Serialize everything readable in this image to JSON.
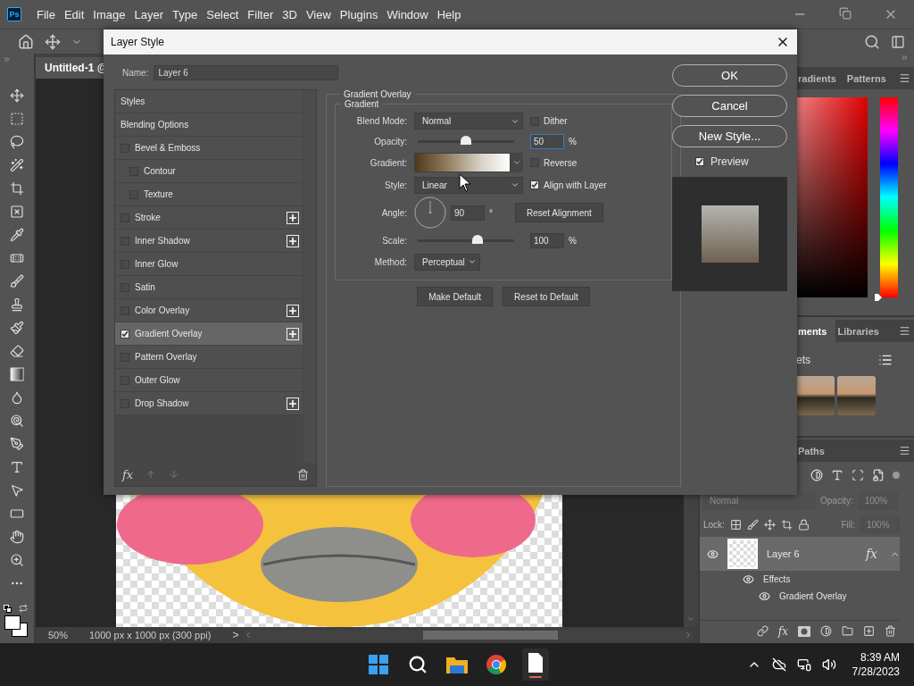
{
  "app": {
    "logo": "Ps",
    "menu": [
      "File",
      "Edit",
      "Image",
      "Layer",
      "Type",
      "Select",
      "Filter",
      "3D",
      "View",
      "Plugins",
      "Window",
      "Help"
    ],
    "doc_tab": "Untitled-1 @",
    "status": {
      "zoom": "50%",
      "info": "1000 px x 1000 px (300 ppi)",
      "arrow": ">"
    }
  },
  "panels": {
    "color_tabs": [
      {
        "label": "radients",
        "selected": false
      },
      {
        "label": "Patterns",
        "selected": false
      }
    ],
    "library_tabs": [
      {
        "label": "ments",
        "selected": true
      },
      {
        "label": "Libraries",
        "selected": false
      }
    ],
    "library_heading": "ets",
    "layers_tabs": [
      {
        "label": "Paths",
        "selected": false
      }
    ],
    "layers": {
      "blend": "Normal",
      "opacity_label": "Opacity:",
      "opacity": "100%",
      "lock_label": "Lock:",
      "fill_label": "Fill:",
      "fill": "100%",
      "disabled": true,
      "fx_button": "fx",
      "rows": [
        {
          "kind": "layer",
          "name": "Layer 6",
          "fx": "fx",
          "selected": true
        },
        {
          "kind": "effects",
          "name": "Effects",
          "selected": false
        },
        {
          "kind": "effect",
          "name": "Gradient Overlay",
          "selected": false
        }
      ]
    }
  },
  "dialog": {
    "title": "Layer Style",
    "name_label": "Name:",
    "name_value": "Layer 6",
    "styles": [
      {
        "label": "Styles",
        "kind": "header",
        "selected": false
      },
      {
        "label": "Blending Options",
        "kind": "header",
        "selected": false
      },
      {
        "label": "Bevel & Emboss",
        "kind": "check",
        "checked": false,
        "add": false,
        "selected": false,
        "children": [
          {
            "label": "Contour",
            "kind": "check",
            "checked": false,
            "add": false,
            "selected": false
          },
          {
            "label": "Texture",
            "kind": "check",
            "checked": false,
            "add": false,
            "selected": false
          }
        ]
      },
      {
        "label": "Stroke",
        "kind": "check",
        "checked": false,
        "add": true,
        "selected": false
      },
      {
        "label": "Inner Shadow",
        "kind": "check",
        "checked": false,
        "add": true,
        "selected": false
      },
      {
        "label": "Inner Glow",
        "kind": "check",
        "checked": false,
        "add": false,
        "selected": false
      },
      {
        "label": "Satin",
        "kind": "check",
        "checked": false,
        "add": false,
        "selected": false
      },
      {
        "label": "Color Overlay",
        "kind": "check",
        "checked": false,
        "add": true,
        "selected": false
      },
      {
        "label": "Gradient Overlay",
        "kind": "check",
        "checked": true,
        "add": true,
        "selected": true
      },
      {
        "label": "Pattern Overlay",
        "kind": "check",
        "checked": false,
        "add": false,
        "selected": false
      },
      {
        "label": "Outer Glow",
        "kind": "check",
        "checked": false,
        "add": false,
        "selected": false
      },
      {
        "label": "Drop Shadow",
        "kind": "check",
        "checked": false,
        "add": true,
        "selected": false
      }
    ],
    "fx_label": "fx",
    "section_title": "Gradient Overlay",
    "group_title": "Gradient",
    "blend_label": "Blend Mode:",
    "blend": "Normal",
    "dither": {
      "label": "Dither",
      "checked": false
    },
    "opacity_label": "Opacity:",
    "opacity": {
      "level": 0.5,
      "value": "50",
      "unit": "%"
    },
    "gradient_label": "Gradient:",
    "reverse": {
      "label": "Reverse",
      "checked": false
    },
    "style_label": "Style:",
    "style": "Linear",
    "align": {
      "label": "Align with Layer",
      "checked": true
    },
    "angle_label": "Angle:",
    "angle": "90",
    "degree": "°",
    "reset_alignment": "Reset Alignment",
    "scale_label": "Scale:",
    "scale": {
      "level": 0.62,
      "value": "100",
      "unit": "%"
    },
    "method_label": "Method:",
    "method": "Perceptual",
    "make_default": "Make Default",
    "reset_default": "Reset to Default",
    "buttons": [
      "OK",
      "Cancel",
      "New Style..."
    ],
    "preview": {
      "label": "Preview",
      "checked": true
    }
  },
  "taskbar": {
    "time": "8:39 AM",
    "date": "7/28/2023"
  }
}
